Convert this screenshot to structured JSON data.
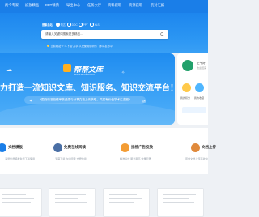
{
  "nav": {
    "items": [
      "找个专家",
      "投放精品",
      "PPT精典",
      "导出中心",
      "任务大厅",
      "资料提取",
      "资源获取",
      "反对汇报"
    ]
  },
  "search": {
    "tabs": [
      "搜索总站",
      "知达",
      "DOC",
      "PPT",
      "XLS"
    ],
    "active_tab": 0,
    "placeholder": "请输入关键词搜索更多精品..."
  },
  "notice": "当前网站“个人下载”共享 以及使用说明书（即将发布中）",
  "banner": {
    "logo_text": "帮帮文库",
    "logo_url": "www.wenku.com",
    "slogan": "力打造一流知识文库、知识服务、知识交流平台！",
    "subline": "#围绕精准投稿审核资源与分享文档上传获取，共建有价值学术生态圈#"
  },
  "sidebar": {
    "title": "上午好",
    "subtitle": "欢迎回来",
    "labels": [
      "我的积分",
      "我的收藏"
    ]
  },
  "features": [
    {
      "icon": "document-icon",
      "title": "文档模板",
      "desc": "海量优质模板免费下载使用"
    },
    {
      "icon": "clipboard-icon",
      "title": "免费在线阅读",
      "desc": "无需下载 在线阅读 方便快捷"
    },
    {
      "icon": "megaphone-icon",
      "title": "挂榜广告投放",
      "desc": "精准投放 曝光率高 效果显著"
    },
    {
      "icon": "upload-icon",
      "title": "文档上传",
      "desc": "原创文档上传享收益"
    }
  ],
  "colors": {
    "primary": "#1a7ee8",
    "accent": "#ffb020",
    "green": "#22a06b"
  }
}
